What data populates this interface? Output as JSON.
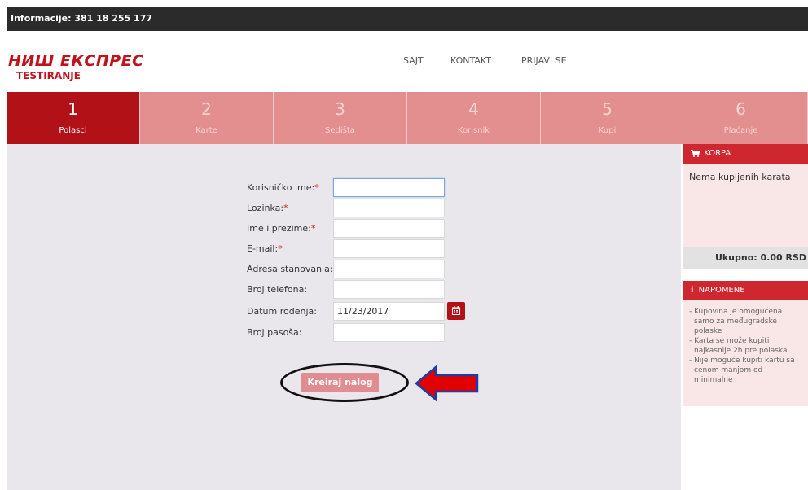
{
  "topbar": {
    "info": "Informacije: 381 18 255 177"
  },
  "logo": {
    "main": "НИШ ЕКСПРЕС",
    "sub": "TESTIRANJE"
  },
  "nav": {
    "items": [
      "SAJT",
      "KONTAKT",
      "PRIJAVI SE"
    ]
  },
  "steps": [
    {
      "num": "1",
      "label": "Polasci",
      "active": true
    },
    {
      "num": "2",
      "label": "Karte",
      "active": false
    },
    {
      "num": "3",
      "label": "Sedišta",
      "active": false
    },
    {
      "num": "4",
      "label": "Korisnik",
      "active": false
    },
    {
      "num": "5",
      "label": "Kupi",
      "active": false
    },
    {
      "num": "6",
      "label": "Plaćanje",
      "active": false
    }
  ],
  "form": {
    "fields": [
      {
        "label": "Korisničko ime:",
        "required": true,
        "value": ""
      },
      {
        "label": "Lozinka:",
        "required": true,
        "value": ""
      },
      {
        "label": "Ime i prezime:",
        "required": true,
        "value": ""
      },
      {
        "label": "E-mail:",
        "required": true,
        "value": ""
      },
      {
        "label": "Adresa stanovanja:",
        "required": false,
        "value": ""
      },
      {
        "label": "Broj telefona:",
        "required": false,
        "value": ""
      },
      {
        "label": "Datum rođenja:",
        "required": false,
        "value": "11/23/2017"
      },
      {
        "label": "Broj pasoša:",
        "required": false,
        "value": ""
      }
    ],
    "required_mark": "*",
    "submit_label": "Kreiraj nalog"
  },
  "cart": {
    "title": "KORPA",
    "empty_text": "Nema kupljenih karata",
    "total": "Ukupno: 0.00 RSD"
  },
  "notes": {
    "title": "NAPOMENE",
    "items": [
      "- Kupovina je omogućena",
      "  samo za međugradske",
      "  polaske",
      "- Karta se može kupiti",
      "  najkasnije 2h pre polaska",
      "- Nije moguće kupiti kartu sa",
      "  cenom manjom od",
      "  minimalne"
    ]
  },
  "colors": {
    "brand_red": "#b11117",
    "step_inactive": "#e38f8f",
    "annotation_arrow": "#e00000"
  }
}
